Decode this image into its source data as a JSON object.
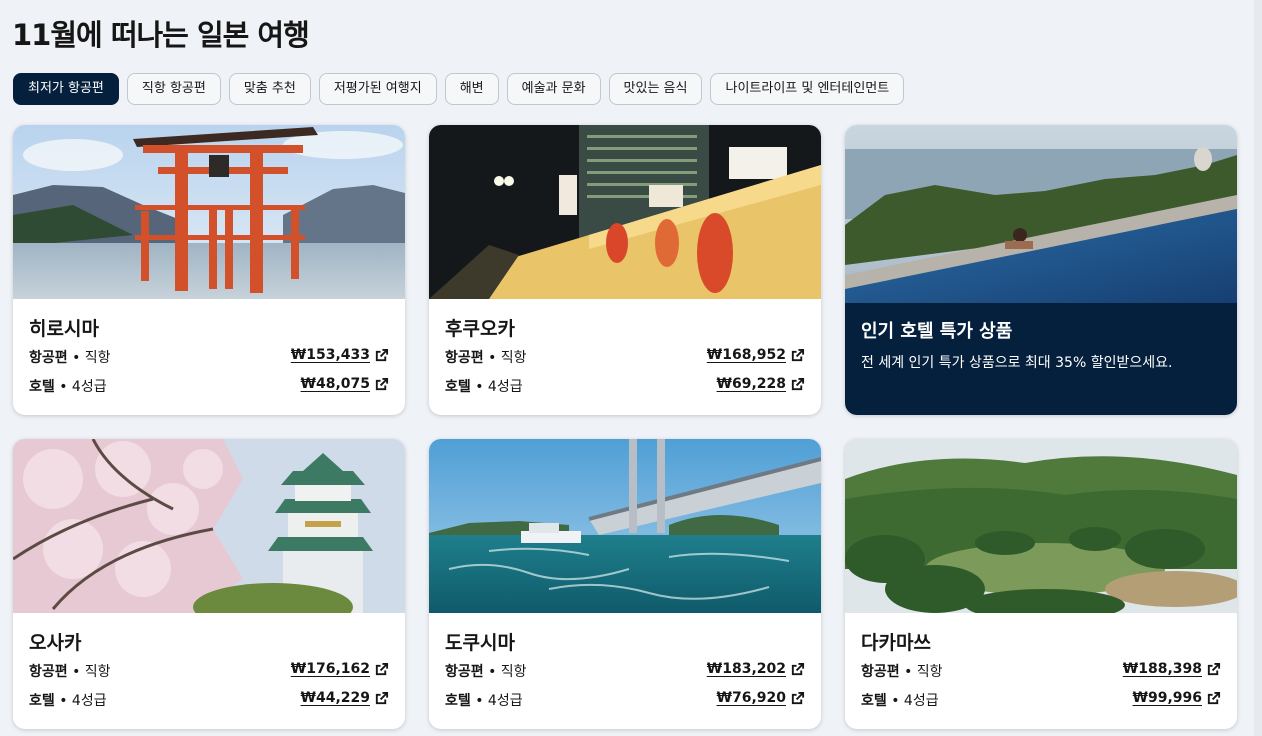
{
  "page": {
    "title": "11월에 떠나는 일본 여행"
  },
  "filters": [
    {
      "label": "최저가 항공편",
      "active": true
    },
    {
      "label": "직항 항공편",
      "active": false
    },
    {
      "label": "맞춤 추천",
      "active": false
    },
    {
      "label": "저평가된 여행지",
      "active": false
    },
    {
      "label": "해변",
      "active": false
    },
    {
      "label": "예술과 문화",
      "active": false
    },
    {
      "label": "맛있는 음식",
      "active": false
    },
    {
      "label": "나이트라이프 및 엔터테인먼트",
      "active": false
    }
  ],
  "cards": [
    {
      "name": "히로시마",
      "flight_label": "항공편",
      "flight_sub": "• 직항",
      "flight_price": "₩153,433",
      "hotel_label": "호텔",
      "hotel_sub": "• 4성급",
      "hotel_price": "₩48,075",
      "image": "itsukushima-torii-photo"
    },
    {
      "name": "후쿠오카",
      "flight_label": "항공편",
      "flight_sub": "• 직항",
      "flight_price": "₩168,952",
      "hotel_label": "호텔",
      "hotel_sub": "• 4성급",
      "hotel_price": "₩69,228",
      "image": "yatai-street-night-photo"
    },
    {
      "name": "오사카",
      "flight_label": "항공편",
      "flight_sub": "• 직항",
      "flight_price": "₩176,162",
      "hotel_label": "호텔",
      "hotel_sub": "• 4성급",
      "hotel_price": "₩44,229",
      "image": "osaka-castle-sakura-photo"
    },
    {
      "name": "도쿠시마",
      "flight_label": "항공편",
      "flight_sub": "• 직항",
      "flight_price": "₩183,202",
      "hotel_label": "호텔",
      "hotel_sub": "• 4성급",
      "hotel_price": "₩76,920",
      "image": "naruto-bridge-whirlpool-photo"
    },
    {
      "name": "다카마쓰",
      "flight_label": "항공편",
      "flight_sub": "• 직항",
      "flight_price": "₩188,398",
      "hotel_label": "호텔",
      "hotel_sub": "• 4성급",
      "hotel_price": "₩99,996",
      "image": "ritsurin-garden-photo"
    }
  ],
  "promo": {
    "title": "인기 호텔 특가 상품",
    "text": "전 세계 인기 특가 상품으로 최대 35% 할인받으세요.",
    "image": "infinity-pool-photo"
  },
  "colors": {
    "brand_dark": "#05203c",
    "page_bg": "#eff2f7",
    "chip_border": "#c1c7cf"
  },
  "icons": {
    "price_link": "external-link-icon"
  }
}
